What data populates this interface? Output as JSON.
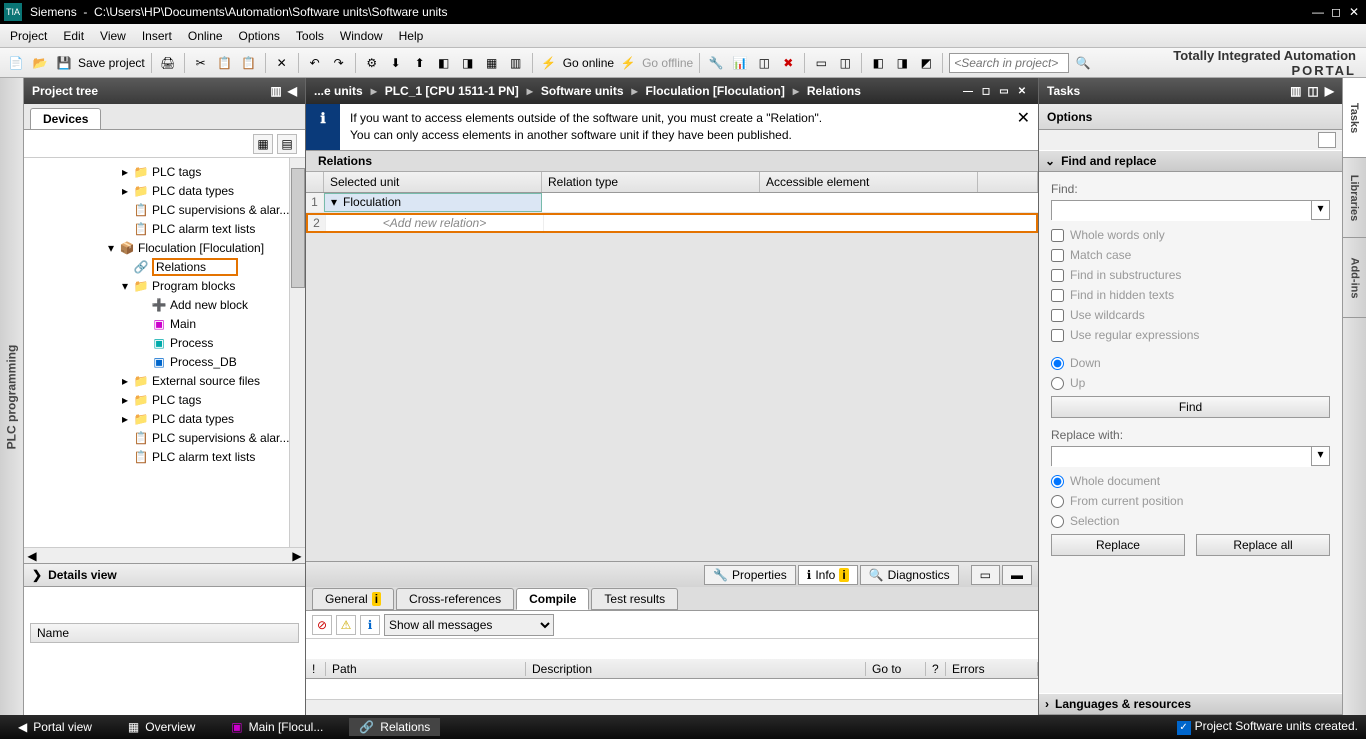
{
  "titlebar": {
    "app": "Siemens",
    "path": "C:\\Users\\HP\\Documents\\Automation\\Software units\\Software units"
  },
  "menu": [
    "Project",
    "Edit",
    "View",
    "Insert",
    "Online",
    "Options",
    "Tools",
    "Window",
    "Help"
  ],
  "toolbar": {
    "save": "Save project",
    "goonline": "Go online",
    "gooffline": "Go offline",
    "search_ph": "<Search in project>"
  },
  "branding": {
    "l1": "Totally Integrated Automation",
    "l2": "PORTAL"
  },
  "left": {
    "title": "Project tree",
    "tab": "Devices",
    "details": "Details view",
    "name_col": "Name"
  },
  "tree": {
    "plc_tags": "PLC tags",
    "plc_data_types": "PLC data types",
    "plc_supervisions": "PLC supervisions & alar...",
    "plc_alarm_text": "PLC alarm text lists",
    "floculation": "Floculation [Floculation]",
    "relations": "Relations",
    "program_blocks": "Program blocks",
    "add_new_block": "Add new block",
    "main": "Main",
    "process": "Process",
    "process_db": "Process_DB",
    "ext_source": "External source files"
  },
  "vtab_left": "PLC programming",
  "breadcrumb": {
    "p1": "...e units",
    "p2": "PLC_1 [CPU 1511-1 PN]",
    "p3": "Software units",
    "p4": "Floculation [Floculation]",
    "p5": "Relations"
  },
  "info_banner": {
    "l1": "If you want to access elements outside of the software unit, you must create a \"Relation\".",
    "l2": "You can only access elements in another software unit if they have been published."
  },
  "relations": {
    "title": "Relations",
    "h1": "Selected unit",
    "h2": "Relation type",
    "h3": "Accessible element",
    "row1": "Floculation",
    "row2": "<Add new relation>"
  },
  "bottom_tabs": {
    "properties": "Properties",
    "info": "Info",
    "diagnostics": "Diagnostics"
  },
  "sub_tabs": {
    "general": "General",
    "cross": "Cross-references",
    "compile": "Compile",
    "test": "Test results"
  },
  "msg": {
    "filter": "Show all messages",
    "h_ex": "!",
    "h_path": "Path",
    "h_desc": "Description",
    "h_goto": "Go to",
    "h_q": "?",
    "h_err": "Errors"
  },
  "right": {
    "title": "Tasks",
    "options": "Options",
    "find_replace": "Find and replace",
    "find": "Find:",
    "whole_words": "Whole words only",
    "match_case": "Match case",
    "find_sub": "Find in substructures",
    "find_hidden": "Find in hidden texts",
    "use_wild": "Use wildcards",
    "use_regex": "Use regular expressions",
    "down": "Down",
    "up": "Up",
    "find_btn": "Find",
    "replace_with": "Replace with:",
    "whole_doc": "Whole document",
    "from_pos": "From current position",
    "selection": "Selection",
    "replace": "Replace",
    "replace_all": "Replace all",
    "lang_res": "Languages & resources"
  },
  "vtabs_right": [
    "Tasks",
    "Libraries",
    "Add-ins"
  ],
  "status": {
    "portal": "Portal view",
    "overview": "Overview",
    "main": "Main [Flocul...",
    "relations": "Relations",
    "msg": "Project Software units created."
  }
}
